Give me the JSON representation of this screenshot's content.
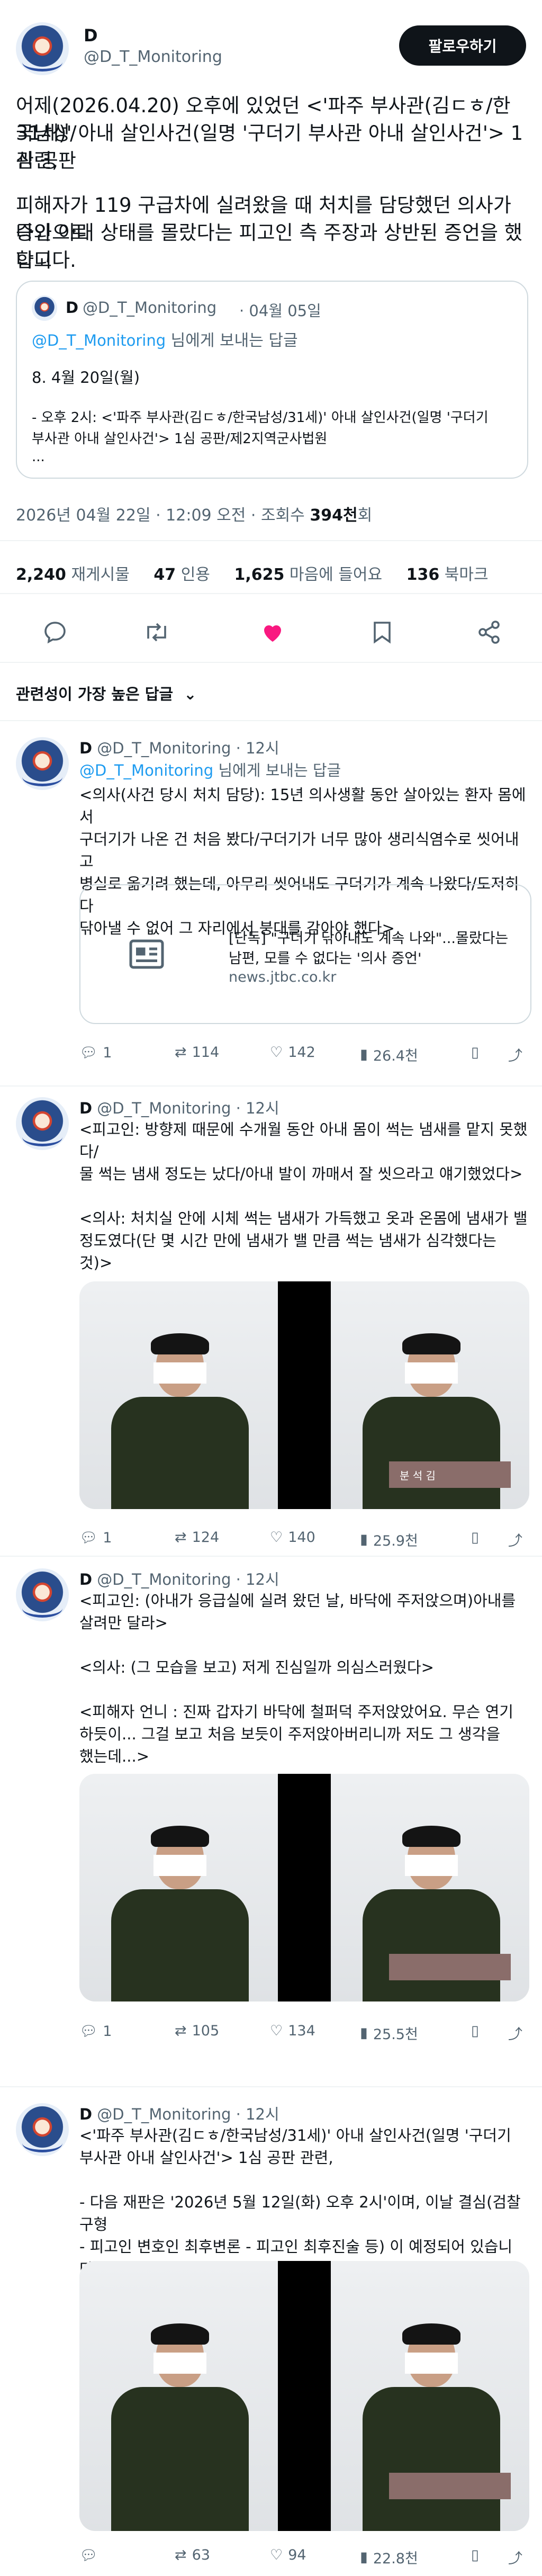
{
  "main_tweet": {
    "name": "D",
    "handle": "@D_T_Monitoring",
    "follow_label": "팔로우하기",
    "text_line1": "어제(2026.04.20) 오후에 있었던 <'파주 부사관(김ㄷㅎ/한국남성/",
    "text_line2": "31세)' 아내 살인사건(일명 '구더기 부사관 아내 살인사건'> 1심 공판",
    "text_line3": "관련,",
    "text_line4": "피해자가 119 구급차에 실려왔을 때 처치를 담당했던 의사가 증인으로",
    "text_line5": "나와 아내 상태를 몰랐다는 피고인 측 주장과 상반된 증언을 했다고",
    "text_line6": "합니다.",
    "quote": {
      "name": "D",
      "handle": "@D_T_Monitoring",
      "date": "· 04월 05일",
      "reply_to_handle": "@D_T_Monitoring",
      "reply_to_suffix": " 님에게 보내는 답글",
      "line1": "8. 4월 20일(월)",
      "line2": "- 오후 2시: <'파주 부사관(김ㄷㅎ/한국남성/31세)' 아내 살인사건(일명 '구더기",
      "line3": "부사관 아내 살인사건'> 1심 공판/제2지역군사법원",
      "line4": "..."
    },
    "timestamp": "2026년 04월 22일 · 12:09 오전 · 조회수",
    "views": "394천",
    "views_suffix": "회",
    "stats": {
      "retweets_num": "2,240",
      "retweets_label": "재게시물",
      "quotes_num": "47",
      "quotes_label": "인용",
      "likes_num": "1,625",
      "likes_label": "마음에 들어요",
      "bookmarks_num": "136",
      "bookmarks_label": "북마크"
    }
  },
  "sort_label": "관련성이 가장 높은 답글",
  "replies": [
    {
      "name": "D",
      "handle": "@D_T_Monitoring",
      "time": "· 12시",
      "reply_to_handle": "@D_T_Monitoring",
      "reply_to_suffix": " 님에게 보내는 답글",
      "text": "<의사(사건 당시 처치 담당): 15년 의사생활 동안 살아있는 환자 몸에서\n구더기가 나온 건 처음 봤다/구더기가 너무 많아 생리식염수로 씻어내고\n병실로 옮기려 했는데, 아무리 씻어내도 구더기가 계속 나왔다/도저히 다\n닦아낼 수 없어 그 자리에서 붕대를 감아야 했다>",
      "card_title": "[단독] \"구더기 닦아내도 계속 나와\"...몰랐다는",
      "card_title2": "남편, 모를 수 없다는 '의사 증언'",
      "card_domain": "news.jtbc.co.kr",
      "replies": "1",
      "retweets": "114",
      "likes": "142",
      "views": "26.4천"
    },
    {
      "name": "D",
      "handle": "@D_T_Monitoring",
      "time": "· 12시",
      "text": "<피고인: 방향제 때문에 수개월 동안 아내 몸이 썩는 냄새를 맡지 못했다/\n물 썩는 냄새 정도는 났다/아내 발이 까매서 잘 씻으라고 얘기했었다>\n\n<의사: 처치실 안에 시체 썩는 냄새가 가득했고 옷과 온몸에 냄새가 밸\n정도였다(단 몇 시간 만에 냄새가 밸 만큼 썩는 냄새가 심각했다는 것)>",
      "replies": "1",
      "retweets": "124",
      "likes": "140",
      "views": "25.9천"
    },
    {
      "name": "D",
      "handle": "@D_T_Monitoring",
      "time": "· 12시",
      "text": "<피고인: (아내가 응급실에 실려 왔던 날, 바닥에 주저앉으며)아내를\n살려만 달라>\n\n<의사: (그 모습을 보고) 저게 진심일까 의심스러웠다>\n\n<피해자 언니 : 진짜 갑자기 바닥에 철퍼덕 주저앉았어요. 무슨 연기\n하듯이... 그걸 보고 처음 보듯이 주저앉아버리니까 저도 그 생각을\n했는데...>",
      "replies": "1",
      "retweets": "105",
      "likes": "134",
      "views": "25.5천"
    },
    {
      "name": "D",
      "handle": "@D_T_Monitoring",
      "time": "· 12시",
      "text": "<'파주 부사관(김ㄷㅎ/한국남성/31세)' 아내 살인사건(일명 '구더기\n부사관 아내 살인사건'> 1심 공판 관련,\n\n- 다음 재판은 '2026년 5월 12일(화) 오후 2시'이며, 이날 결심(검찰 구형\n- 피고인 변호인 최후변론 - 피고인 최후진술 등) 이 예정되어 있습니다.",
      "replies": "",
      "retweets": "63",
      "likes": "94",
      "views": "22.8천"
    }
  ],
  "photo_labels": {
    "nameplate": "분 석  김"
  },
  "colors": {
    "like_pink": "#f91880",
    "link_blue": "#1d9bf0",
    "muted": "#536471"
  }
}
